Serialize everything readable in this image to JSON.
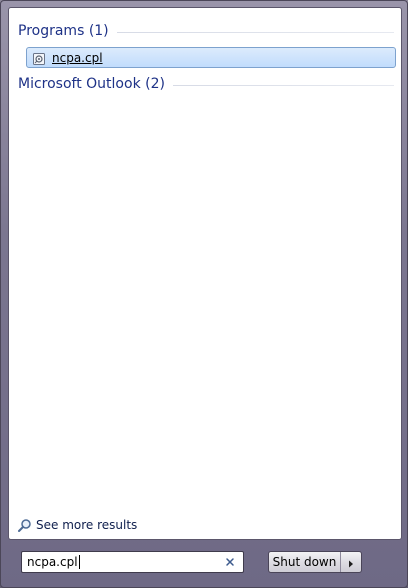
{
  "results": {
    "groups": [
      {
        "title": "Programs (1)",
        "items": [
          {
            "label": "ncpa.cpl",
            "icon": "control-panel-applet-icon"
          }
        ]
      },
      {
        "title": "Microsoft Outlook (2)",
        "items": []
      }
    ],
    "see_more_label": "See more results",
    "see_more_icon": "magnifier-icon"
  },
  "search": {
    "value": "ncpa.cpl",
    "clear_icon": "clear-x-icon"
  },
  "shutdown": {
    "label": "Shut down",
    "arrow_icon": "arrow-right-icon"
  },
  "colors": {
    "group_title": "#1e3287",
    "selected_item_border": "#7da2ce",
    "selected_item_fill": "#c1dcfc",
    "frame": "#7b7690"
  }
}
